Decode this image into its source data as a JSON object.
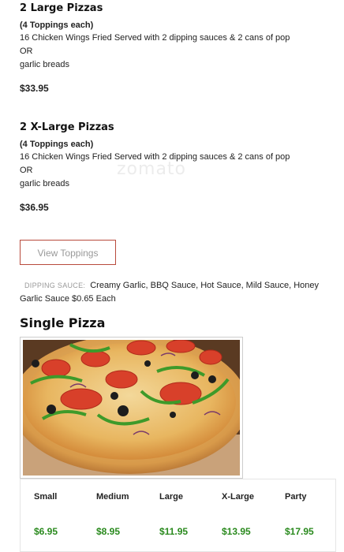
{
  "combos": [
    {
      "title": "2 Large Pizzas",
      "subtitle": "(4 Toppings each)",
      "line1": "16 Chicken Wings Fried Served with 2 dipping sauces & 2 cans of pop",
      "line2": "OR",
      "line3": "garlic breads",
      "price": "$33.95"
    },
    {
      "title": "2 X-Large Pizzas",
      "subtitle": "(4 Toppings each)",
      "line1": "16 Chicken Wings Fried Served with 2 dipping sauces & 2 cans of pop",
      "line2": "OR",
      "line3": "garlic breads",
      "price": "$36.95"
    }
  ],
  "toppings_button": "View Toppings",
  "dipping": {
    "label": "DIPPING SAUCE:",
    "text": "Creamy Garlic, BBQ Sauce, Hot Sauce, Mild Sauce, Honey Garlic Sauce $0.65 Each"
  },
  "section_title": "Single Pizza",
  "watermark": "zomato",
  "sizes": [
    {
      "name": "Small",
      "price": "$6.95"
    },
    {
      "name": "Medium",
      "price": "$8.95"
    },
    {
      "name": "Large",
      "price": "$11.95"
    },
    {
      "name": "X-Large",
      "price": "$13.95"
    },
    {
      "name": "Party",
      "price": "$17.95"
    }
  ],
  "colors": {
    "price_green": "#2a8a1e",
    "button_border": "#b84a3c"
  }
}
